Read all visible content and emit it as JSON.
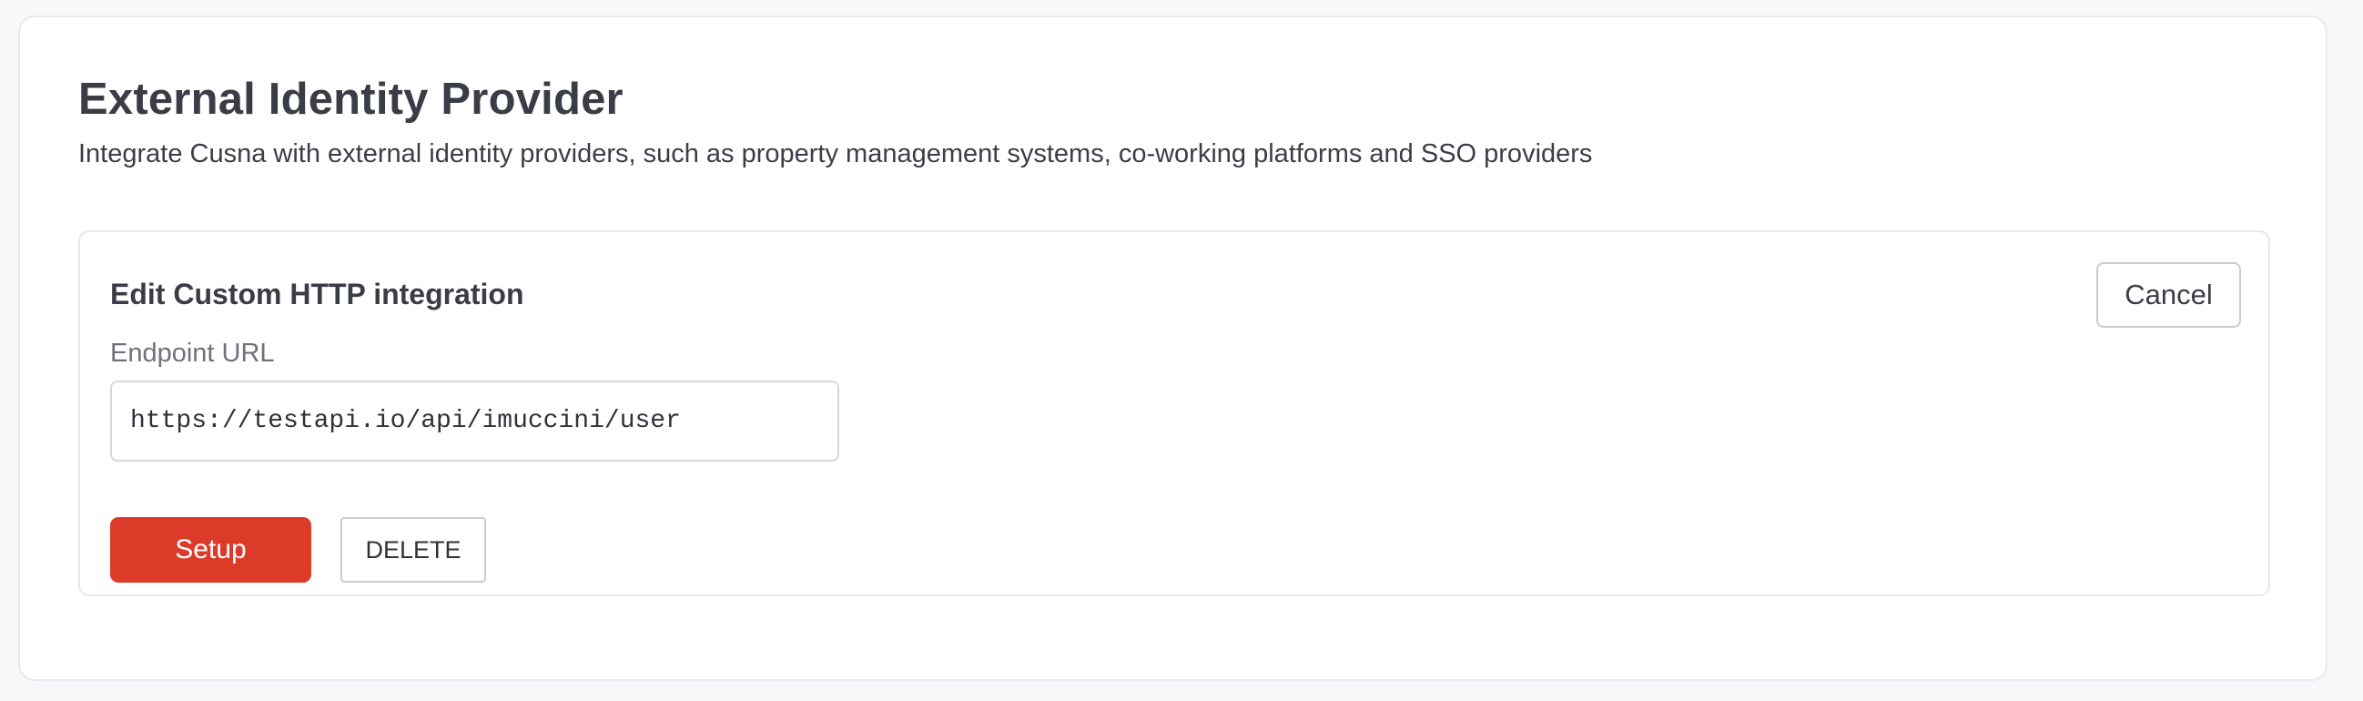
{
  "page": {
    "title": "External Identity Provider",
    "subtitle": "Integrate Cusna with external identity providers, such as property management systems, co-working platforms and SSO providers"
  },
  "integration": {
    "section_title": "Edit Custom HTTP integration",
    "endpoint_label": "Endpoint URL",
    "endpoint_value": "https://testapi.io/api/imuccini/user",
    "endpoint_placeholder": "",
    "setup_label": "Setup",
    "delete_label": "DELETE",
    "cancel_label": "Cancel"
  },
  "colors": {
    "primary_button": "#dc3b2a",
    "background": "#f7f8fa",
    "card": "#ffffff"
  }
}
